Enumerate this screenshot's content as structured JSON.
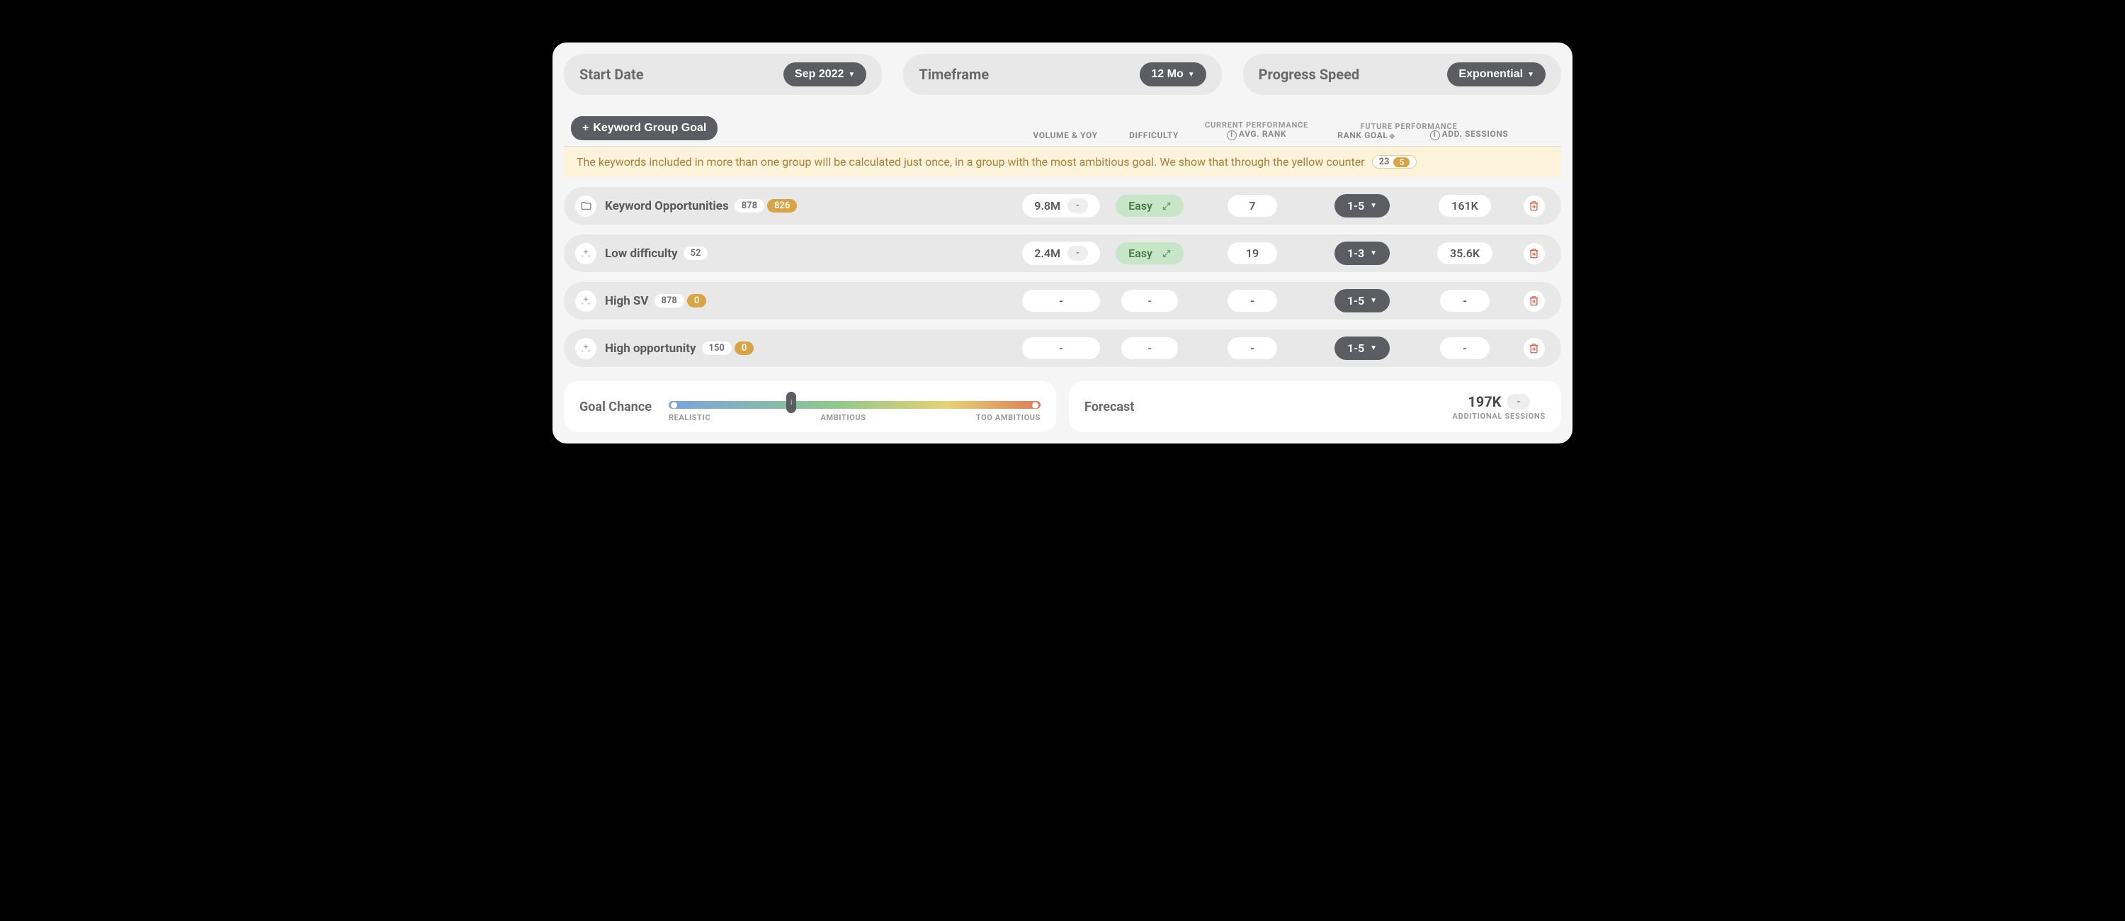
{
  "controls": {
    "start_date": {
      "label": "Start Date",
      "value": "Sep 2022"
    },
    "timeframe": {
      "label": "Timeframe",
      "value": "12 Mo"
    },
    "progress_speed": {
      "label": "Progress Speed",
      "value": "Exponential"
    }
  },
  "add_button": "Keyword Group Goal",
  "columns": {
    "volume": "VOLUME & YOY",
    "difficulty": "DIFFICULTY",
    "avg_rank": "AVG. RANK",
    "rank_goal": "RANK GOAL",
    "add_sessions": "ADD. SESSIONS",
    "section_current": "CURRENT PERFORMANCE",
    "section_future": "FUTURE PERFORMANCE"
  },
  "notice": {
    "text": "The keywords included in more than one group will be calculated just once, in a group with the most ambitious goal. We show that through the yellow counter",
    "count": "23",
    "highlight": "5"
  },
  "rows": [
    {
      "icon": "folder",
      "name": "Keyword Opportunities",
      "count": "878",
      "yellow": "826",
      "volume": "9.8M",
      "yoy": "-",
      "difficulty": "Easy",
      "avg_rank": "7",
      "rank_goal": "1-5",
      "sessions": "161K"
    },
    {
      "icon": "sparkle",
      "name": "Low difficulty",
      "count": "52",
      "yellow": "",
      "volume": "2.4M",
      "yoy": "-",
      "difficulty": "Easy",
      "avg_rank": "19",
      "rank_goal": "1-3",
      "sessions": "35.6K"
    },
    {
      "icon": "sparkle",
      "name": "High SV",
      "count": "878",
      "yellow": "0",
      "volume": "-",
      "yoy": "",
      "difficulty": "-",
      "avg_rank": "-",
      "rank_goal": "1-5",
      "sessions": "-"
    },
    {
      "icon": "sparkle",
      "name": "High opportunity",
      "count": "150",
      "yellow": "0",
      "volume": "-",
      "yoy": "",
      "difficulty": "-",
      "avg_rank": "-",
      "rank_goal": "1-5",
      "sessions": "-"
    }
  ],
  "goal_chance": {
    "label": "Goal Chance",
    "realistic": "REALISTIC",
    "ambitious": "AMBITIOUS",
    "too_ambitious": "TOO AMBITIOUS"
  },
  "forecast": {
    "label": "Forecast",
    "value": "197K",
    "delta": "-",
    "sub": "ADDITIONAL SESSIONS"
  }
}
